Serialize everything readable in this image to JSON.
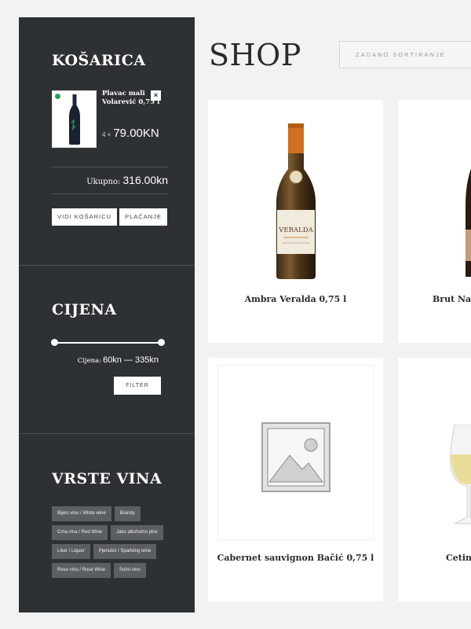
{
  "sidebar": {
    "cart": {
      "title": "KOŠARICA",
      "item_name": "Plavac mali Volarević 0,75 l",
      "remove_label": "×",
      "quantity_prefix": "4 ×",
      "price": "79.00KN",
      "subtotal_label": "Ukupno:",
      "subtotal_value": "316.00kn",
      "view_cart_label": "VIDI KOŠARICU",
      "checkout_label": "PLAĆANJE"
    },
    "price_filter": {
      "title": "CIJENA",
      "price_label": "Cijena:",
      "price_range": "60kn — 335kn",
      "filter_button": "FILTER",
      "min_value": 60,
      "max_value": 335
    },
    "categories": {
      "title": "VRSTE VINA",
      "tags": [
        "Bijelo vino / White wine",
        "Brandy",
        "Crna vina / Red Wine",
        "Jako alkoholno pice",
        "Liker / Liquer",
        "Pjenušci / Sparkling wine",
        "Rose vino / Rose Wine",
        "Suho vino"
      ]
    }
  },
  "main": {
    "title": "SHOP",
    "sort_label": "Zadano sortiranje",
    "products": [
      {
        "name": "Ambra Veralda 0,75 l",
        "image": "wine-bottle-image",
        "bottle_label": "VERALDA"
      },
      {
        "name": "Brut Natu",
        "image": "wine-bottle-image"
      },
      {
        "name": "Cabernet sauvignon Bačić 0,75 l",
        "image": "placeholder-image"
      },
      {
        "name": "Cetink",
        "image": "wine-glass-image"
      }
    ]
  },
  "colors": {
    "sidebar_bg": "#2d3133",
    "page_bg": "#f2f2f2",
    "tag_bg": "#5b5f62"
  }
}
